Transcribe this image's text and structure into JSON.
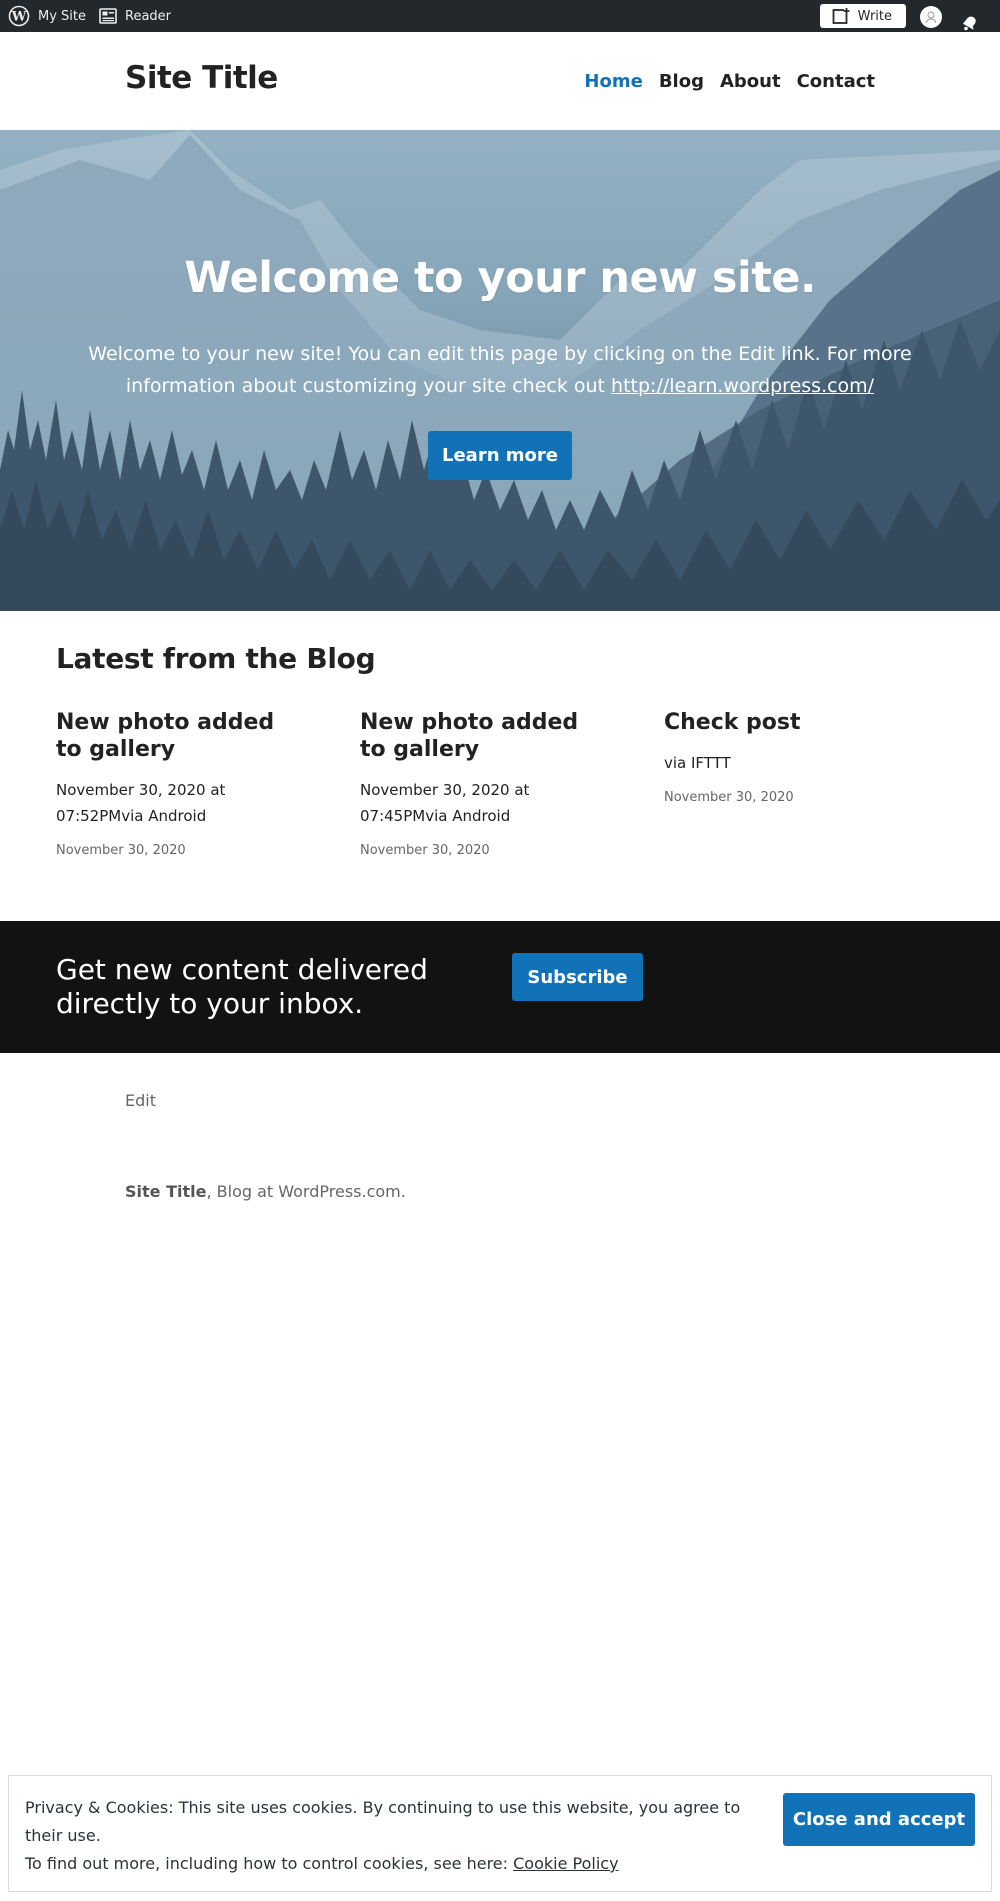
{
  "adminbar": {
    "my_site": "My Site",
    "reader": "Reader",
    "write": "Write",
    "icons": [
      "wordpress-logo-icon",
      "reader-icon",
      "write-icon",
      "avatar-icon",
      "notifications-bell-icon"
    ]
  },
  "header": {
    "site_title": "Site Title",
    "nav": [
      "Home",
      "Blog",
      "About",
      "Contact"
    ],
    "active_nav": "Home",
    "accent_color": "#1172b8"
  },
  "hero": {
    "title": "Welcome to your new site.",
    "text": "Welcome to your new site! You can edit this page by clicking on the Edit link. For more information about customizing your site check out ",
    "link": "http://learn.wordpress.com/",
    "button": "Learn more"
  },
  "blog": {
    "heading": "Latest from the Blog",
    "posts": [
      {
        "title": "New photo added to gallery",
        "excerpt": "November 30, 2020 at 07:52PMvia Android",
        "date": "November 30, 2020"
      },
      {
        "title": "New photo added to gallery",
        "excerpt": "November 30, 2020 at 07:45PMvia Android",
        "date": "November 30, 2020"
      },
      {
        "title": "Check post",
        "excerpt": "via IFTTT",
        "date": "November 30, 2020"
      }
    ]
  },
  "subscribe": {
    "text": "Get new content delivered directly to your inbox.",
    "button": "Subscribe"
  },
  "footer": {
    "edit": "Edit",
    "site_title": "Site Title",
    "credit": ", Blog at WordPress.com."
  },
  "cookie": {
    "text": "Privacy & Cookies: This site uses cookies. By continuing to use this website, you agree to their use.",
    "more": "To find out more, including how to control cookies, see here: ",
    "policy_link": "Cookie Policy",
    "button": "Close and accept"
  }
}
